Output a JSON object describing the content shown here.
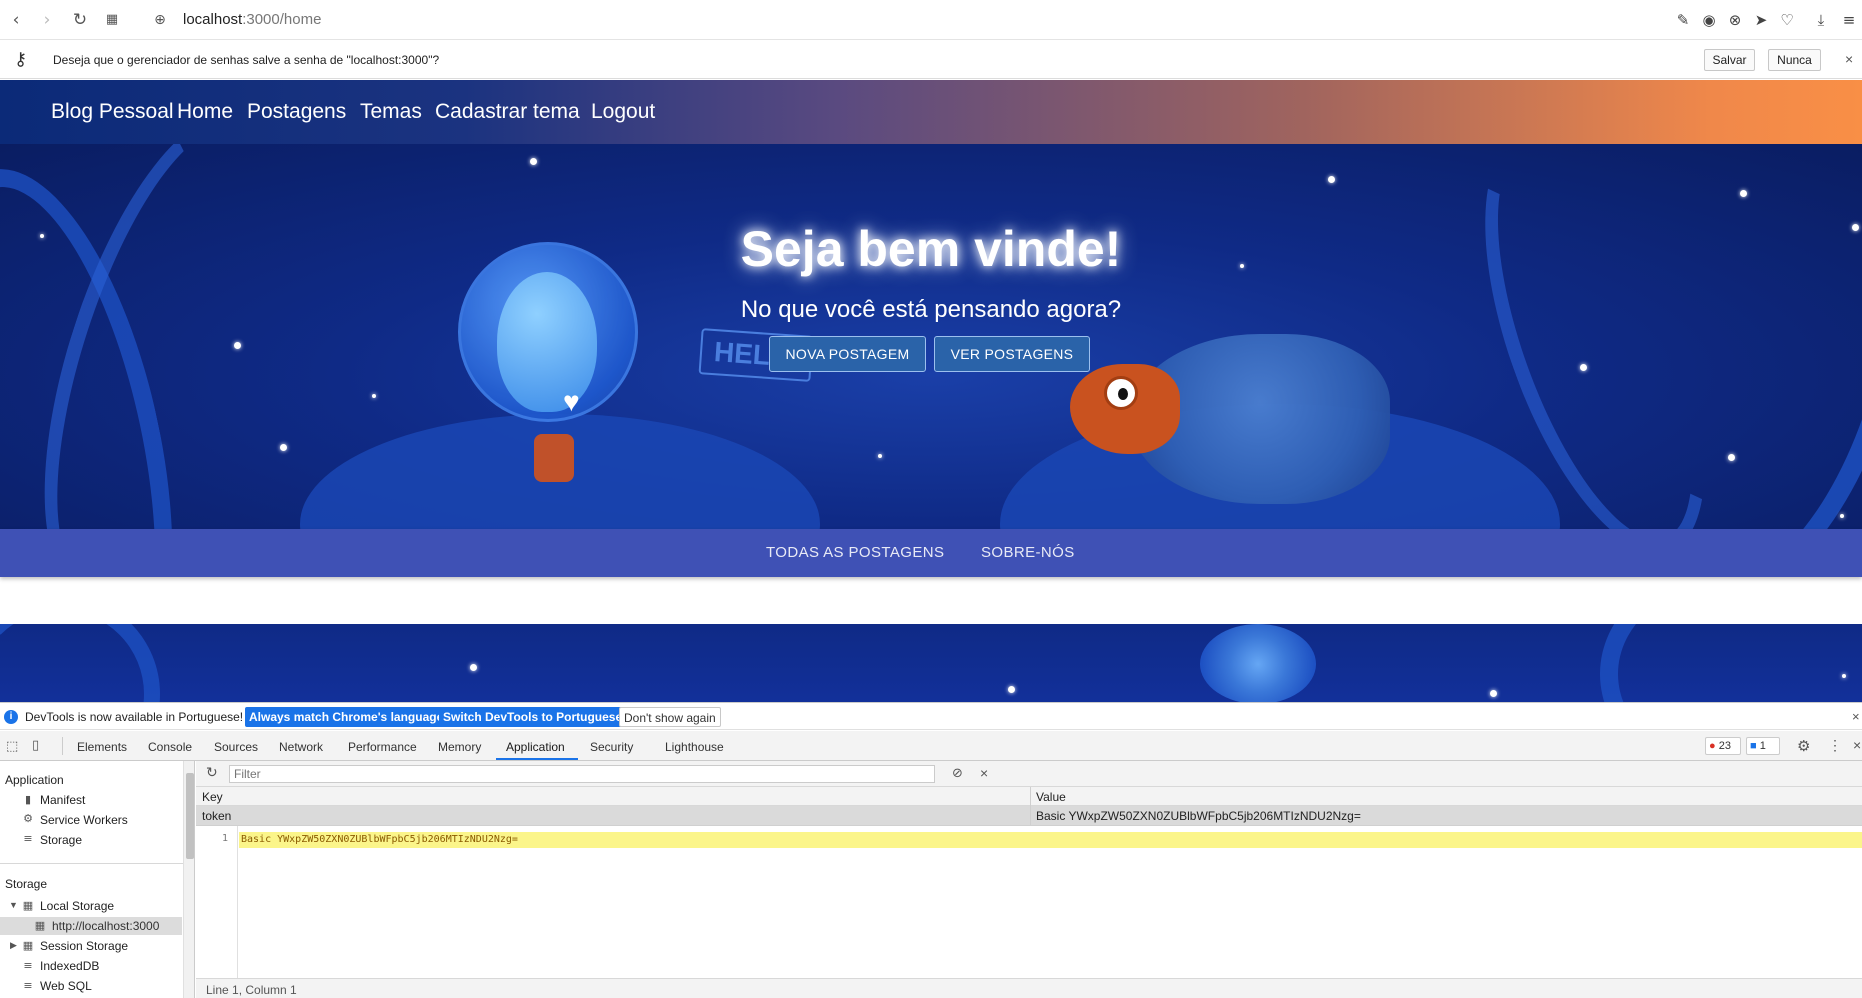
{
  "browser": {
    "url_host": "localhost",
    "url_rest": ":3000/home",
    "password_prompt": "Deseja que o gerenciador de senhas salve a senha de \"localhost:3000\"?",
    "save_label": "Salvar",
    "never_label": "Nunca"
  },
  "site_nav": {
    "brand": "Blog Pessoal",
    "links": [
      "Home",
      "Postagens",
      "Temas",
      "Cadastrar tema",
      "Logout"
    ]
  },
  "hero": {
    "title": "Seja bem vinde!",
    "subtitle": "No que você está pensando agora?",
    "new_post_label": "NOVA POSTAGEM",
    "view_posts_label": "VER POSTAGENS"
  },
  "tabs": [
    "TODAS AS POSTAGENS",
    "SOBRE-NÓS"
  ],
  "devtools": {
    "info_text": "DevTools is now available in Portuguese!",
    "match_label": "Always match Chrome's language",
    "switch_label": "Switch DevTools to Portuguese",
    "dont_show_label": "Don't show again",
    "panel_tabs": [
      "Elements",
      "Console",
      "Sources",
      "Network",
      "Performance",
      "Memory",
      "Application",
      "Security",
      "Lighthouse"
    ],
    "active_tab": "Application",
    "error_count": "23",
    "message_count": "1",
    "sidebar": {
      "application_title": "Application",
      "application_items": [
        "Manifest",
        "Service Workers",
        "Storage"
      ],
      "storage_title": "Storage",
      "local_storage": "Local Storage",
      "local_storage_origin": "http://localhost:3000",
      "session_storage": "Session Storage",
      "indexeddb": "IndexedDB",
      "websql": "Web SQL"
    },
    "filter_placeholder": "Filter",
    "table": {
      "key_header": "Key",
      "value_header": "Value",
      "row_key": "token",
      "row_value": "Basic YWxpZW50ZXN0ZUBlbWFpbC5jb206MTIzNDU2Nzg="
    },
    "code_line_number": "1",
    "code_text": "Basic YWxpZW50ZXN0ZUBlbWFpbC5jb206MTIzNDU2Nzg=",
    "status": "Line 1, Column 1"
  }
}
